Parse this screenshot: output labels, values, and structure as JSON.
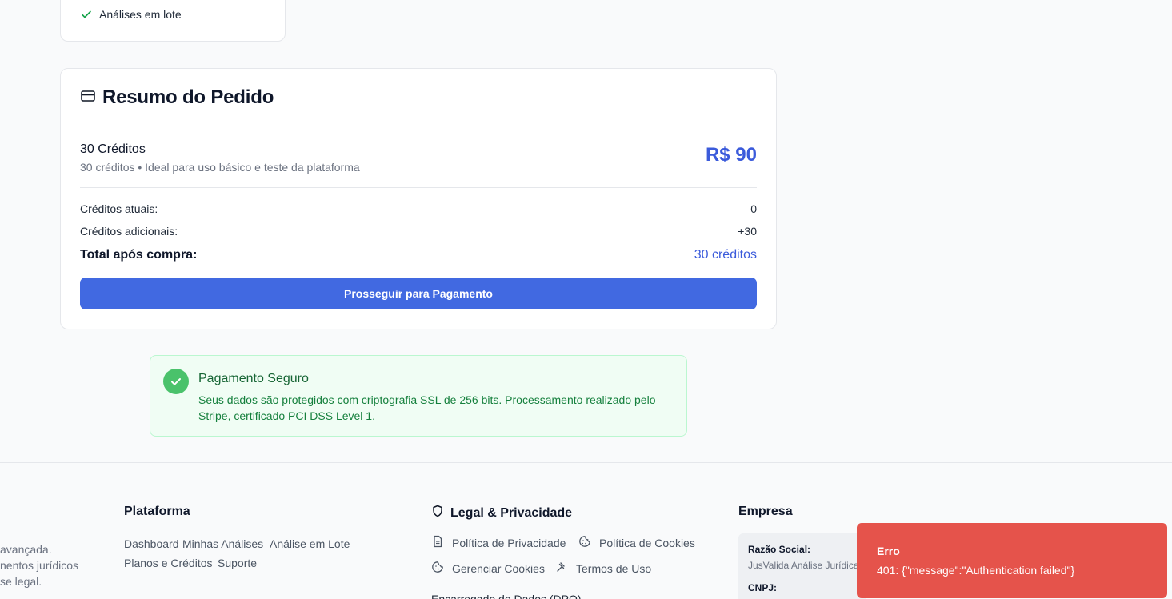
{
  "plan_card": {
    "feature": "Análises em lote"
  },
  "summary": {
    "title": "Resumo do Pedido",
    "package_name": "30 Créditos",
    "package_desc": "30 créditos • Ideal para uso básico e teste da plataforma",
    "price": "R$ 90",
    "current_label": "Créditos atuais:",
    "current_value": "0",
    "additional_label": "Créditos adicionais:",
    "additional_value": "+30",
    "total_label": "Total após compra:",
    "total_value": "30 créditos",
    "button_label": "Prosseguir para Pagamento"
  },
  "secure": {
    "title": "Pagamento Seguro",
    "text": "Seus dados são protegidos com criptografia SSL de 256 bits. Processamento realizado pelo Stripe, certificado PCI DSS Level 1."
  },
  "footer": {
    "about_lines": [
      "avançada.",
      "nentos jurídicos",
      "se legal."
    ],
    "platform": {
      "heading": "Plataforma",
      "links": [
        "Dashboard",
        "Minhas Análises",
        "Análise em Lote",
        "Planos e Créditos",
        "Suporte"
      ]
    },
    "legal": {
      "heading": "Legal & Privacidade",
      "privacy": "Política de Privacidade",
      "cookies": "Política de Cookies",
      "manage_cookies": "Gerenciar Cookies",
      "terms": "Termos de Uso",
      "dpo": "Encarregado de Dados (DPO)"
    },
    "company": {
      "heading": "Empresa",
      "razao_label": "Razão Social:",
      "razao_value": "JusValida Análise Jurídica",
      "cnpj_label": "CNPJ:"
    }
  },
  "toast": {
    "title": "Erro",
    "message": "401: {\"message\":\"Authentication failed\"}"
  },
  "colors": {
    "accent": "#4169e1",
    "price": "#3b5bdb",
    "success_bg": "#f0fdf4",
    "success_icon": "#4ac26b",
    "error": "#e5534b"
  }
}
